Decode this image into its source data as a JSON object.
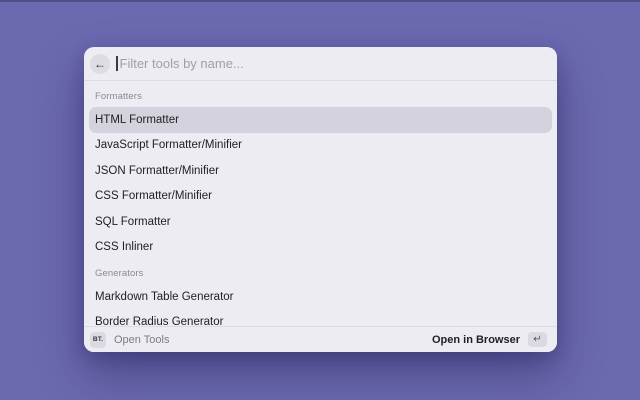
{
  "window": {
    "background_color": "#6b69b0"
  },
  "palette": {
    "search": {
      "placeholder": "Filter tools by name...",
      "back_icon": "←"
    },
    "sections": [
      {
        "label": "Formatters",
        "items": [
          {
            "label": "HTML Formatter",
            "selected": true
          },
          {
            "label": "JavaScript Formatter/Minifier",
            "selected": false
          },
          {
            "label": "JSON Formatter/Minifier",
            "selected": false
          },
          {
            "label": "CSS Formatter/Minifier",
            "selected": false
          },
          {
            "label": "SQL Formatter",
            "selected": false
          },
          {
            "label": "CSS Inliner",
            "selected": false
          }
        ]
      },
      {
        "label": "Generators",
        "items": [
          {
            "label": "Markdown Table Generator",
            "selected": false
          },
          {
            "label": "Border Radius Generator",
            "selected": false
          }
        ]
      }
    ],
    "footer": {
      "app_badge": "BT.",
      "app_label": "Open Tools",
      "action_label": "Open in Browser",
      "action_key_icon": "↵"
    }
  },
  "colors": {
    "background": "#6b69b0",
    "background_edge": "#514f87",
    "panel": "#edecf2",
    "selected_row": "#d4d2dc",
    "divider": "#dcdae2",
    "chip": "#dbd9e1",
    "text_primary": "#202025",
    "text_muted": "#8b8992",
    "placeholder": "#a09ea8"
  }
}
